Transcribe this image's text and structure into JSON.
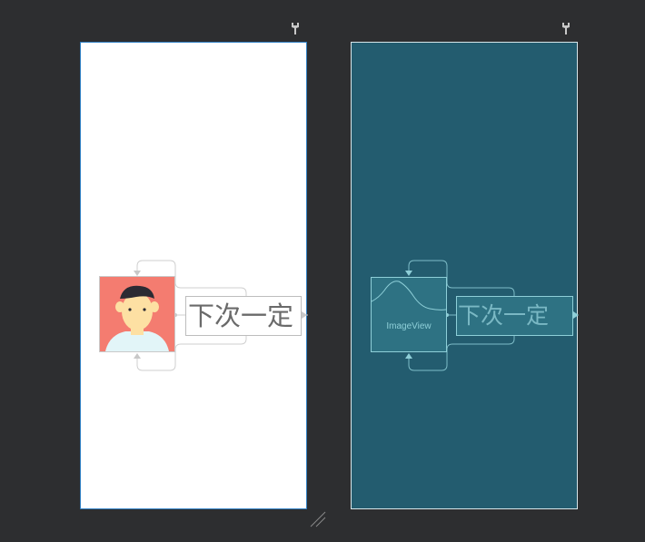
{
  "colors": {
    "background": "#2d2e30",
    "design_surface": "#ffffff",
    "design_border": "#2f7fc3",
    "blueprint_surface": "#235c6f",
    "blueprint_accent": "#8ecfd8",
    "avatar_background": "#f47c70",
    "avatar_skin": "#fde0a3",
    "avatar_hair": "#2b2b33",
    "avatar_shirt": "#e2f5f8"
  },
  "icons": {
    "design_settings": "wrench-icon",
    "blueprint_settings": "wrench-icon",
    "resize": "resize-handle-icon"
  },
  "design_view": {
    "text_view": {
      "text": "下次一定"
    },
    "image_view": {
      "content": "avatar-icon"
    }
  },
  "blueprint_view": {
    "text_view": {
      "text": "下次一定"
    },
    "image_view": {
      "label": "ImageView"
    }
  }
}
